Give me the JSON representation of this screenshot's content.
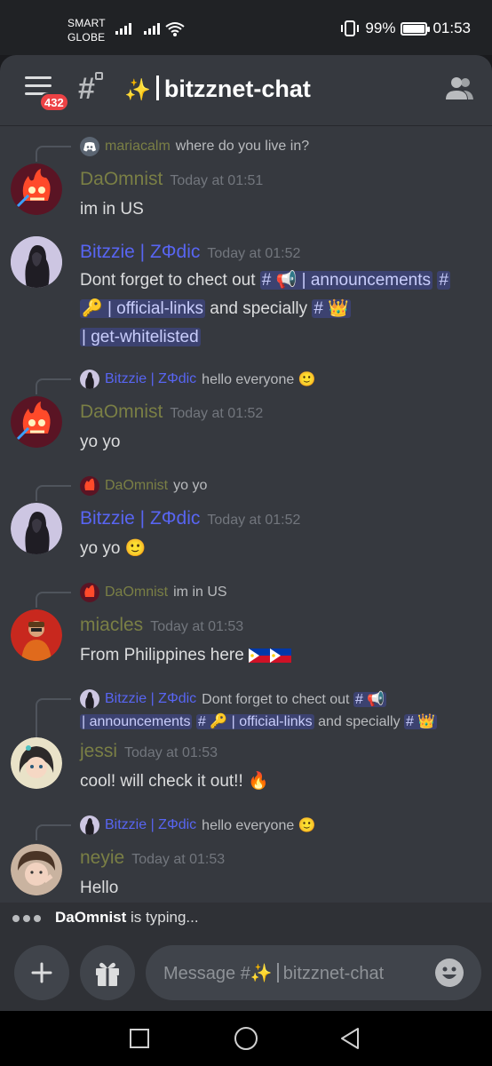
{
  "status_bar": {
    "carrier_line1": "SMART",
    "carrier_line2": "GLOBE",
    "battery": "99%",
    "time": "01:53"
  },
  "header": {
    "notification_badge": "432",
    "channel_title": "bitzznet-chat",
    "icons": [
      "hamburger-menu-icon",
      "locked-channel-icon",
      "sparkles-icon",
      "members-icon"
    ]
  },
  "messages": [
    {
      "reply": {
        "author": "mariacalm",
        "text": "where do you live in?"
      },
      "author": "DaOmnist",
      "time": "Today at 01:51",
      "body": "im in US"
    },
    {
      "author": "Bitzzie | ZΦdic",
      "time": "Today at 01:52",
      "body_parts": {
        "t1": "Dont forget to chect out",
        "m1": "| announcements",
        "m2": "| official-links",
        "t2": "and specially",
        "m3": "| get-whitelisted"
      }
    },
    {
      "reply": {
        "author": "Bitzzie | ZΦdic",
        "text": "hello everyone"
      },
      "author": "DaOmnist",
      "time": "Today at 01:52",
      "body": "yo yo"
    },
    {
      "reply": {
        "author": "DaOmnist",
        "text": "yo yo"
      },
      "author": "Bitzzie | ZΦdic",
      "time": "Today at 01:52",
      "body": "yo yo"
    },
    {
      "reply": {
        "author": "DaOmnist",
        "text": "im in US"
      },
      "author": "miacles",
      "time": "Today at 01:53",
      "body": "From Philippines here"
    },
    {
      "reply": {
        "author": "Bitzzie | ZΦdic",
        "t1": "Dont forget to chect out",
        "m1": "| announcements",
        "m2": "| official-links",
        "t2": "and specially"
      },
      "author": "jessi",
      "time": "Today at 01:53",
      "body": "cool! will check it out!!"
    },
    {
      "reply": {
        "author": "Bitzzie | ZΦdic",
        "text": "hello everyone"
      },
      "author": "neyie",
      "time": "Today at 01:53",
      "body": "Hello"
    }
  ],
  "typing": {
    "user": "DaOmnist",
    "suffix": "is typing..."
  },
  "composer": {
    "placeholder_prefix": "Message #",
    "placeholder_channel": "bitzznet-chat"
  },
  "colors": {
    "background": "#36393f",
    "mention_bg": "#3c4270",
    "badge": "#ed4245",
    "role_blurple": "#5865f2",
    "role_olive": "#7a7f45"
  }
}
